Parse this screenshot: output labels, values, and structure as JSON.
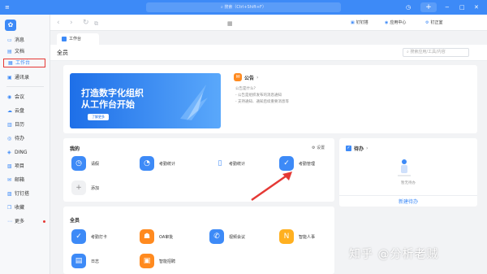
{
  "topbar": {
    "search_text": "搜索（Ctrl+Shift+F）",
    "add_label": "+"
  },
  "sidebar": {
    "avatar_letter": "",
    "items": [
      {
        "label": "消息"
      },
      {
        "label": "文档"
      },
      {
        "label": "工作台"
      },
      {
        "label": "通讯录"
      },
      {
        "label": "会议"
      },
      {
        "label": "云盘"
      },
      {
        "label": "日历"
      },
      {
        "label": "待办"
      },
      {
        "label": "DING"
      },
      {
        "label": "项目"
      },
      {
        "label": "邮箱"
      },
      {
        "label": "钉钉搭"
      },
      {
        "label": "收藏"
      },
      {
        "label": "更多"
      }
    ]
  },
  "toolbar": {
    "right": [
      {
        "label": "钉钉搭"
      },
      {
        "label": "应用中心"
      },
      {
        "label": "钉正室"
      }
    ]
  },
  "tab": {
    "label": "工作台"
  },
  "subhead": {
    "title": "全员",
    "search_placeholder": "搜索应用/工具/内容"
  },
  "banner": {
    "line1": "打造数字化组织",
    "line2": "从工作台开始",
    "button": "了解更多"
  },
  "notice": {
    "title": "公告",
    "lines": [
      "公告是什么？",
      "- 公告是组织发布的消息通知",
      "- 支持通知、通知后续重要消息等"
    ]
  },
  "mine": {
    "title": "我的",
    "setting": "设置",
    "apps": [
      {
        "label": "请假",
        "icon": "calendar",
        "color": "#3d8af7"
      },
      {
        "label": "考勤统计",
        "icon": "pie",
        "color": "#3d8af7"
      },
      {
        "label": "考勤统计",
        "icon": "bar",
        "color": "#3d8af7"
      },
      {
        "label": "考勤管理",
        "icon": "shield",
        "color": "#3d8af7"
      },
      {
        "label": "添加",
        "icon": "plus",
        "color": "#f0f1f3"
      }
    ]
  },
  "all": {
    "title": "全员",
    "apps": [
      {
        "label": "考勤打卡",
        "icon": "clock",
        "color": "#3d8af7"
      },
      {
        "label": "OA审批",
        "icon": "user",
        "color": "#ff8a1f"
      },
      {
        "label": "视频会议",
        "icon": "phone",
        "color": "#3d8af7"
      },
      {
        "label": "智能人事",
        "icon": "n",
        "color": "#ffb020"
      },
      {
        "label": "日志",
        "icon": "log",
        "color": "#3d8af7"
      },
      {
        "label": "智能招聘",
        "icon": "recruit",
        "color": "#ff8a1f"
      }
    ]
  },
  "todo": {
    "title": "待办",
    "empty_text": "暂无待办",
    "new_link": "新建待办"
  },
  "watermark": "知乎 @分析老贼",
  "colors": {
    "accent": "#3d8af7",
    "highlight": "#e53935",
    "orange": "#ff8a1f"
  }
}
